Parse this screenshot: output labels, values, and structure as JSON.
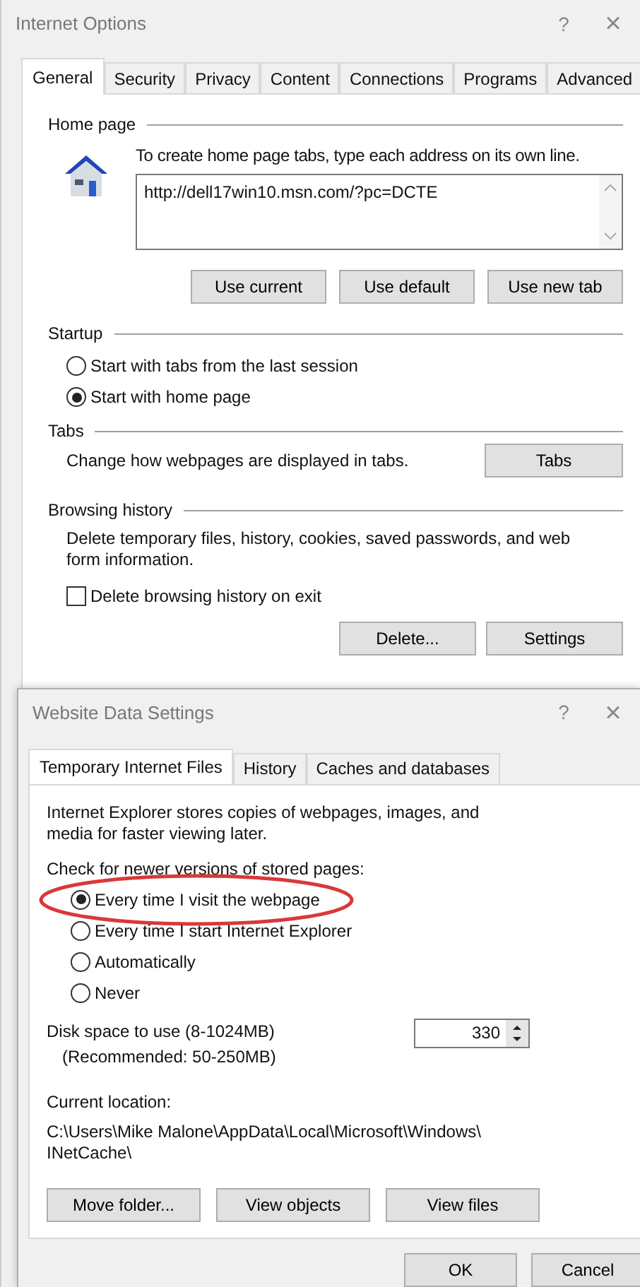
{
  "back_window": {
    "title": "Internet Options",
    "help": "?",
    "close": "×",
    "tabs": [
      {
        "label": "General",
        "selected": true
      },
      {
        "label": "Security",
        "selected": false
      },
      {
        "label": "Privacy",
        "selected": false
      },
      {
        "label": "Content",
        "selected": false
      },
      {
        "label": "Connections",
        "selected": false
      },
      {
        "label": "Programs",
        "selected": false
      },
      {
        "label": "Advanced",
        "selected": false
      }
    ],
    "home_page": {
      "heading": "Home page",
      "hint": "To create home page tabs, type each address on its own line.",
      "value": "http://dell17win10.msn.com/?pc=DCTE",
      "buttons": [
        "Use current",
        "Use default",
        "Use new tab"
      ]
    },
    "startup": {
      "heading": "Startup",
      "options": [
        {
          "label": "Start with tabs from the last session",
          "selected": false
        },
        {
          "label": "Start with home page",
          "selected": true
        }
      ]
    },
    "tabs_section": {
      "heading": "Tabs",
      "text": "Change how webpages are displayed in tabs.",
      "button": "Tabs"
    },
    "browsing_history": {
      "heading": "Browsing history",
      "text": "Delete temporary files, history, cookies, saved passwords, and web form information.",
      "checkbox": {
        "label": "Delete browsing history on exit",
        "checked": false
      },
      "buttons": [
        "Delete...",
        "Settings"
      ]
    }
  },
  "front_window": {
    "title": "Website Data Settings",
    "help": "?",
    "close": "×",
    "tabs": [
      {
        "label": "Temporary Internet Files",
        "selected": true
      },
      {
        "label": "History",
        "selected": false
      },
      {
        "label": "Caches and databases",
        "selected": false
      }
    ],
    "intro": "Internet Explorer stores copies of webpages, images, and media for faster viewing later.",
    "check_label": "Check for newer versions of stored pages:",
    "options": [
      {
        "label": "Every time I visit the webpage",
        "selected": true,
        "highlighted": true
      },
      {
        "label": "Every time I start Internet Explorer",
        "selected": false,
        "highlighted": false
      },
      {
        "label": "Automatically",
        "selected": false,
        "highlighted": false
      },
      {
        "label": "Never",
        "selected": false,
        "highlighted": false
      }
    ],
    "disk_label": "Disk space to use (8-1024MB)",
    "disk_recommended": "(Recommended: 50-250MB)",
    "disk_value": "330",
    "location_label": "Current location:",
    "location_path": "C:\\Users\\Mike Malone\\AppData\\Local\\Microsoft\\Windows\\ INetCache\\",
    "buttons": [
      "Move folder...",
      "View objects",
      "View files"
    ],
    "footer_buttons": [
      "OK",
      "Cancel"
    ]
  }
}
